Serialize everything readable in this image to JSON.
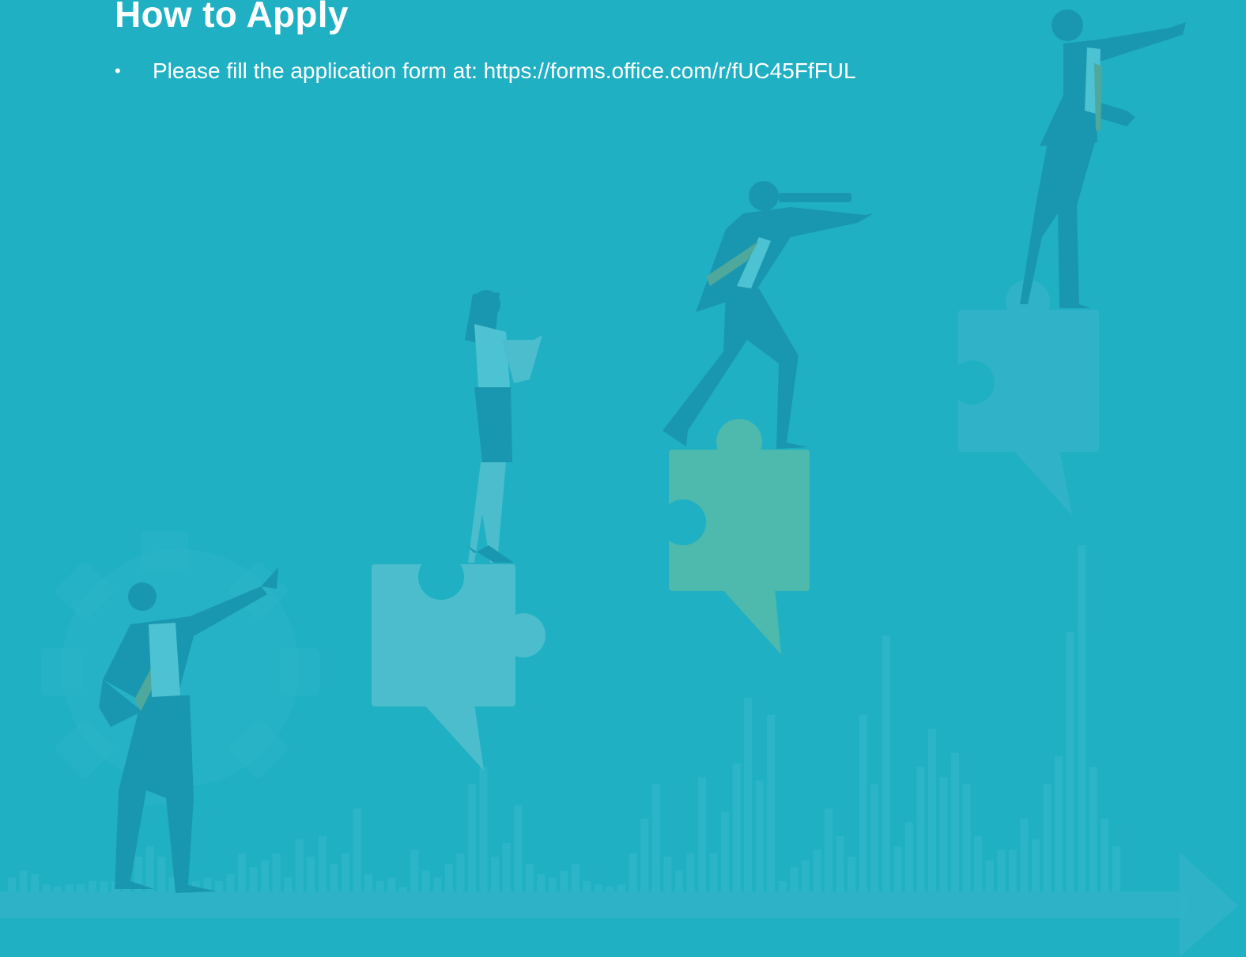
{
  "slide": {
    "title": "How to Apply",
    "bullets": [
      {
        "text": "Please fill the application form at: https://forms.office.com/r/fUC45FfFUL"
      }
    ]
  },
  "colors": {
    "background": "#1fb0c4",
    "text": "#ffffff",
    "figure": "#1a97b0",
    "puzzle_light": "#4bbdcd",
    "puzzle_green": "#4eb9ad",
    "puzzle_mid": "#30b3c8",
    "tie": "#4fa89c"
  },
  "illustration": {
    "icons": [
      "gear-icon",
      "puzzle-piece-icon",
      "speech-bubble-icon",
      "growth-arrow-icon",
      "bar-chart-icon"
    ],
    "bar_levels": [
      0.04,
      0.06,
      0.05,
      0.02,
      0.01,
      0.02,
      0.02,
      0.03,
      0.03,
      0.03,
      0.05,
      0.1,
      0.13,
      0.1,
      0.04,
      0.02,
      0.03,
      0.04,
      0.03,
      0.05,
      0.11,
      0.07,
      0.09,
      0.11,
      0.04,
      0.15,
      0.1,
      0.16,
      0.08,
      0.11,
      0.24,
      0.05,
      0.03,
      0.04,
      0.01,
      0.12,
      0.06,
      0.04,
      0.08,
      0.11,
      0.31,
      0.36,
      0.1,
      0.14,
      0.25,
      0.08,
      0.05,
      0.04,
      0.06,
      0.08,
      0.03,
      0.02,
      0.01,
      0.02,
      0.11,
      0.21,
      0.31,
      0.1,
      0.06,
      0.11,
      0.33,
      0.11,
      0.23,
      0.37,
      0.56,
      0.32,
      0.51,
      0.03,
      0.07,
      0.09,
      0.12,
      0.24,
      0.16,
      0.1,
      0.51,
      0.31,
      0.74,
      0.13,
      0.2,
      0.36,
      0.47,
      0.33,
      0.4,
      0.31,
      0.16,
      0.09,
      0.12,
      0.12,
      0.21,
      0.15,
      0.31,
      0.39,
      0.75,
      1.0,
      0.36,
      0.21,
      0.13
    ]
  }
}
